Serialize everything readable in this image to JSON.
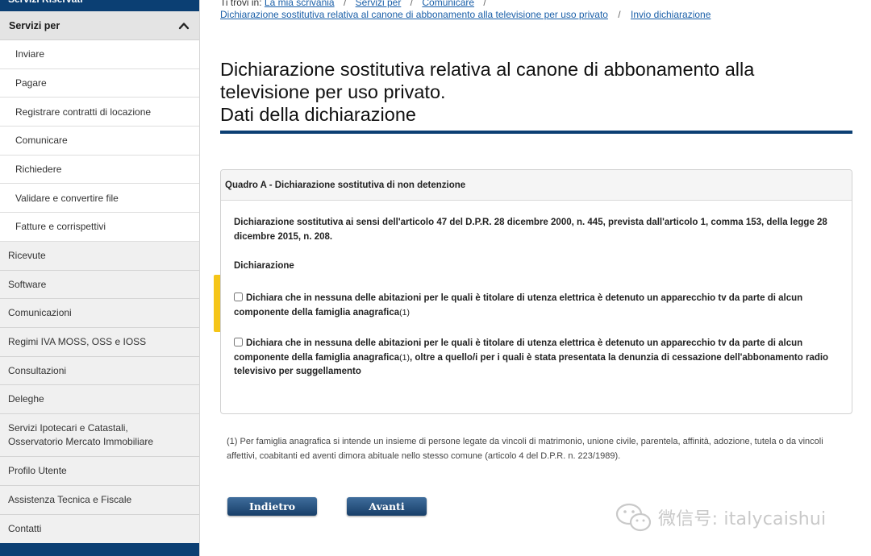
{
  "sidebar": {
    "top_label": "Servizi Riservati",
    "section_label": "Servizi per",
    "sub_items": [
      {
        "label": "Inviare"
      },
      {
        "label": "Pagare"
      },
      {
        "label": "Registrare contratti di locazione"
      },
      {
        "label": "Comunicare"
      },
      {
        "label": "Richiedere"
      },
      {
        "label": "Validare e convertire file"
      },
      {
        "label": "Fatture e corrispettivi"
      }
    ],
    "items": [
      {
        "label": "Ricevute"
      },
      {
        "label": "Software"
      },
      {
        "label": "Comunicazioni"
      },
      {
        "label": "Regimi IVA MOSS, OSS e IOSS"
      },
      {
        "label": "Consultazioni"
      },
      {
        "label": "Deleghe"
      },
      {
        "label": "Servizi Ipotecari e Catastali, Osservatorio Mercato Immobiliare"
      },
      {
        "label": "Profilo Utente"
      },
      {
        "label": "Assistenza Tecnica e Fiscale"
      },
      {
        "label": "Contatti"
      }
    ]
  },
  "breadcrumb": {
    "prefix": "Ti trovi in:",
    "links": [
      "La mia scrivania",
      "Servizi per",
      "Comunicare"
    ],
    "row2_links": [
      "Dichiarazione sostitutiva relativa al canone di abbonamento alla televisione per uso privato",
      "Invio dichiarazione"
    ],
    "separator": "/"
  },
  "page": {
    "title_line1": "Dichiarazione sostitutiva relativa al canone di abbonamento alla",
    "title_line2": "televisione per uso privato.",
    "title_line3": "Dati della dichiarazione"
  },
  "quadro": {
    "header": "Quadro A - Dichiarazione sostitutiva di non detenzione",
    "intro": "Dichiarazione sostitutiva ai sensi dell'articolo 47 del D.P.R. 28 dicembre 2000, n. 445, prevista dall'articolo 1, comma 153, della legge 28 dicembre 2015, n. 208.",
    "section_label": "Dichiarazione",
    "option1": "Dichiara che in nessuna delle abitazioni per le quali è titolare di utenza elettrica è detenuto un apparecchio tv da parte di alcun componente della famiglia anagrafica",
    "option1_sup": "(1)",
    "option2_a": "Dichiara che in nessuna delle abitazioni per le quali è titolare di utenza elettrica è detenuto un apparecchio tv da parte di alcun componente della famiglia anagrafica",
    "option2_sup": "(1)",
    "option2_b": ", oltre a quello/i per i quali è stata presentata la denunzia di cessazione dell'abbonamento radio televisivo per suggellamento",
    "option1_checked": false,
    "option2_checked": false
  },
  "footnote": {
    "marker": "(1)",
    "text": " Per famiglia anagrafica si intende un insieme di persone legate da vincoli di matrimonio, unione civile, parentela, affinità, adozione, tutela o da vincoli affettivi, coabitanti ed aventi dimora abituale nello stesso comune (articolo 4 del D.P.R. n. 223/1989)."
  },
  "buttons": {
    "back": "Indietro",
    "next": "Avanti"
  },
  "watermark": {
    "text": "微信号: italycaishui"
  },
  "colors": {
    "brand_dark": "#0b3f73",
    "link": "#1a5fa8",
    "highlight": "#f5c518"
  }
}
